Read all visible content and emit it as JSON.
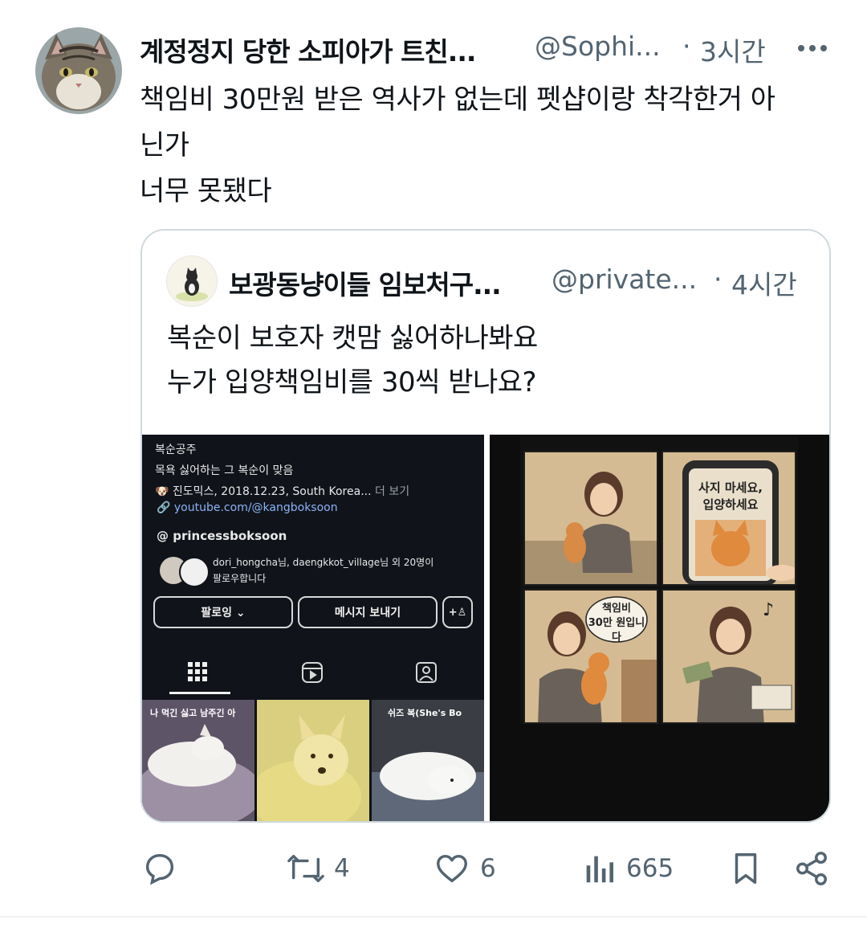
{
  "tweet": {
    "author_name": "계정정지 당한 소피아가 트친...",
    "author_handle": "@Sophi...",
    "separator": "·",
    "time": "3시간",
    "text": "책임비 30만원 받은 역사가 없는데 펫샵이랑 착각한거 아\n닌가\n너무 못됐다"
  },
  "quoted": {
    "author_name": "보광동냥이들 임보처구...",
    "author_handle": "@private...",
    "separator": "·",
    "time": "4시간",
    "text": "복순이 보호자 캣맘 싫어하나봐요\n누가 입양책임비를 30씩 받나요?",
    "instagram": {
      "name": "복순공주",
      "bio": "목욕 싫어하는 그 복순이 맞음",
      "info": "🐶 진도믹스, 2018.12.23, South Korea...",
      "more": "더 보기",
      "link": "youtube.com/@kangboksoon",
      "threads": "princessboksoon",
      "followers_line1": "dori_hongcha님, daengkkot_village님 외 20명이",
      "followers_line2": "팔로우합니다",
      "follow_button": "팔로잉 ⌄",
      "message_button": "메시지 보내기",
      "thumb1_caption": "나 먹긴 싫고 남주긴 아",
      "thumb3_caption": "쉬즈 복(She's Bo"
    },
    "comic": {
      "bubble1": "사지 마세요,\n입양하세요",
      "bubble2": "책임비\n30만 원입니다",
      "note": "♪"
    }
  },
  "actions": {
    "replies": "",
    "retweets": "4",
    "likes": "6",
    "views": "665"
  },
  "colors": {
    "text": "#0f1419",
    "secondary": "#536471",
    "border": "#cfd9de"
  }
}
